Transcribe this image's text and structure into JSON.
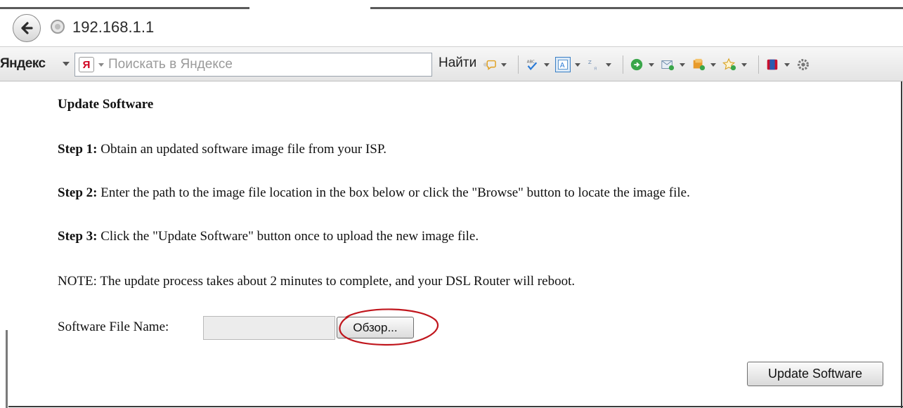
{
  "browser": {
    "url": "192.168.1.1"
  },
  "toolbar": {
    "brand_label": "Яндекс",
    "search_badge": "Я",
    "search_placeholder": "Поискать в Яндексе",
    "find_label": "Найти",
    "icons": [
      "assistant-icon",
      "spellcheck-icon",
      "translate-page-icon",
      "translate-word-icon",
      "refresh-icon",
      "mail-icon",
      "bookmarks-icon",
      "favorites-icon",
      "bar-icon",
      "settings-icon"
    ]
  },
  "page": {
    "title": "Update Software",
    "step1_label": "Step 1:",
    "step1_text": " Obtain an updated software image file from your ISP.",
    "step2_label": "Step 2:",
    "step2_text": " Enter the path to the image file location in the box below or click the \"Browse\" button to locate the image file.",
    "step3_label": "Step 3:",
    "step3_text": " Click the \"Update Software\" button once to upload the new image file.",
    "note": "NOTE: The update process takes about 2 minutes to complete, and your DSL Router will reboot.",
    "file_label": "Software File Name:",
    "file_value": "",
    "browse_label": "Обзор...",
    "update_label": "Update Software"
  },
  "colors": {
    "annotation": "#c0161d",
    "brand_red": "#d0001f"
  }
}
